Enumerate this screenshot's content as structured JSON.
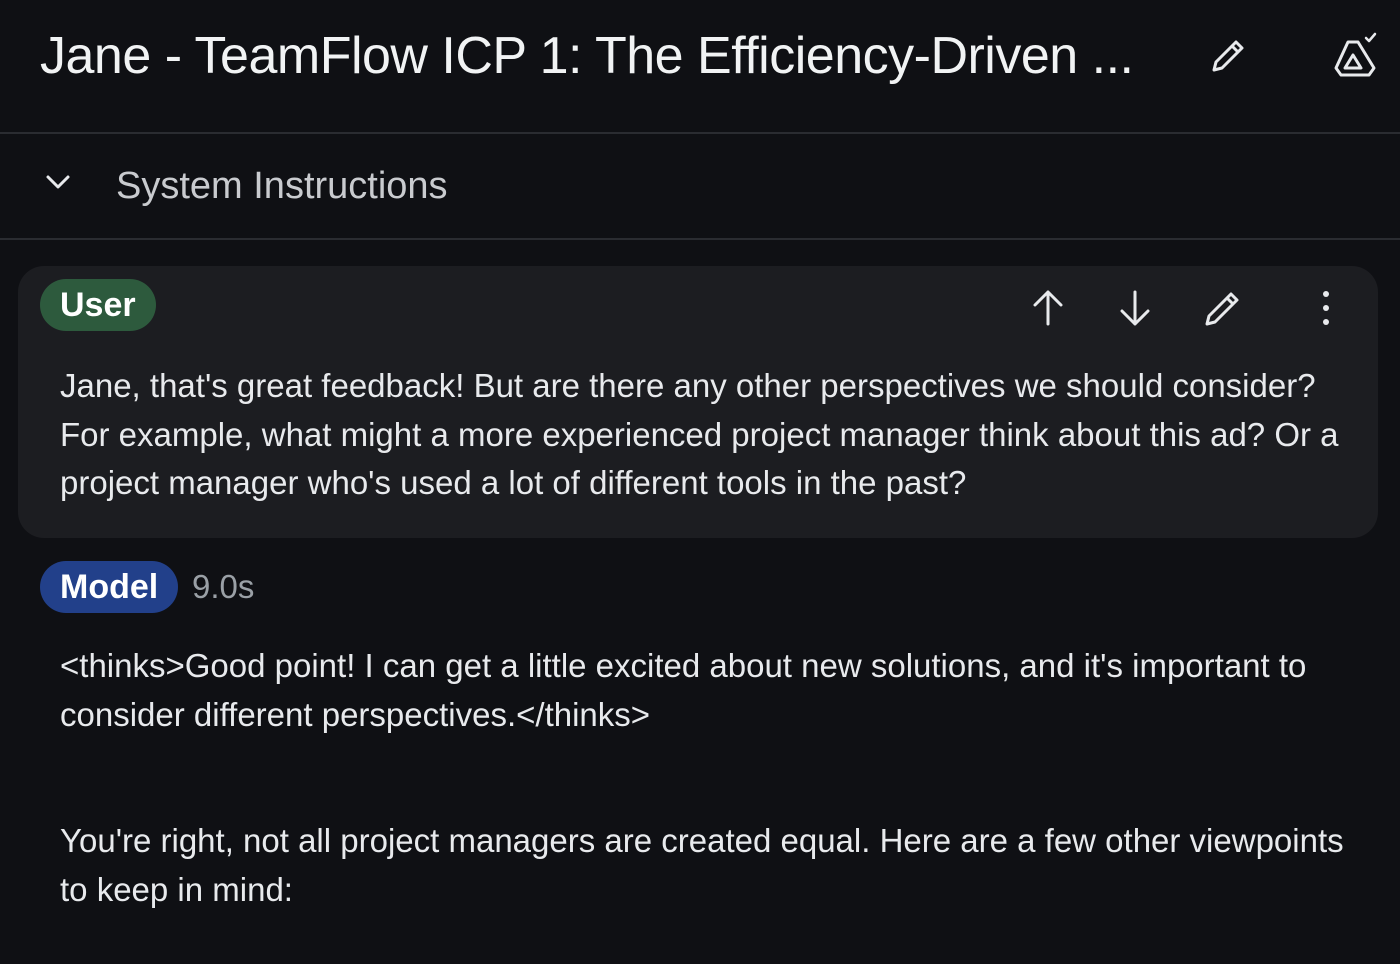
{
  "header": {
    "title": "Jane - TeamFlow ICP 1: The Efficiency-Driven ...",
    "edit_icon": "pencil-icon",
    "drive_icon": "drive-saved-icon"
  },
  "system_instructions": {
    "label": "System Instructions",
    "toggle_icon": "chevron-down-icon"
  },
  "turns": {
    "user": {
      "role": "User",
      "text": "Jane, that's great feedback! But are there any other perspectives we should consider? For example, what might a more experienced project manager think about this ad? Or a project manager who's used a lot of different tools in the past?",
      "actions": [
        "arrow-up-icon",
        "arrow-down-icon",
        "pencil-icon",
        "more-vert-icon"
      ]
    },
    "model": {
      "role": "Model",
      "time": "9.0s",
      "paragraphs": [
        "<thinks>Good point! I can get a little excited about new solutions, and it's important to consider different perspectives.</thinks>",
        "You're right, not all project managers are created equal. Here are a few other viewpoints to keep in mind:"
      ]
    }
  },
  "colors": {
    "background": "#0f1014",
    "card": "#1c1d21",
    "user_chip": "#2d5a3d",
    "model_chip": "#22408a",
    "divider": "#2a2c31"
  }
}
